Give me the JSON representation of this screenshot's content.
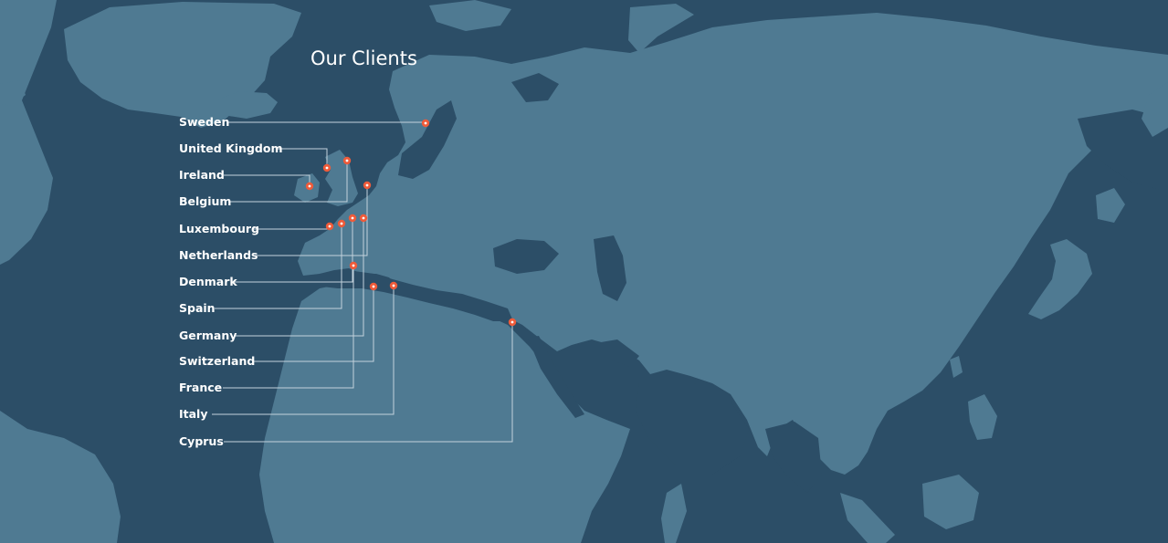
{
  "title": "Our Clients",
  "colors": {
    "ocean": "#2c4e67",
    "land": "#4f7a92",
    "water_inland": "#2c4e67",
    "marker": "#ee5b3a",
    "leader_line": "#c3d2dc",
    "text": "#ffffff"
  },
  "clients": [
    {
      "name": "Sweden"
    },
    {
      "name": "United Kingdom"
    },
    {
      "name": "Ireland"
    },
    {
      "name": "Belgium"
    },
    {
      "name": "Luxembourg"
    },
    {
      "name": "Netherlands"
    },
    {
      "name": "Denmark"
    },
    {
      "name": "Spain"
    },
    {
      "name": "Germany"
    },
    {
      "name": "Switzerland"
    },
    {
      "name": "France"
    },
    {
      "name": "Italy"
    },
    {
      "name": "Cyprus"
    }
  ]
}
